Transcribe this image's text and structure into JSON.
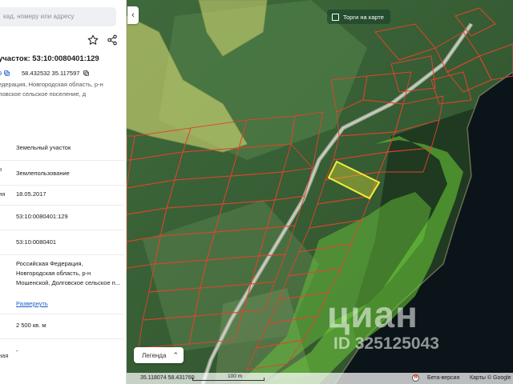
{
  "search": {
    "placeholder": "кад. номеру или адресу"
  },
  "panel": {
    "title": "участок: 53:10:0080401:129",
    "coord_prefix": "9",
    "coords": "58.432532 35.117597",
    "address_lines": [
      "едерация, Новгородская область, р-н",
      "ловское сельское поселение, д"
    ],
    "rows": [
      {
        "label": "",
        "value": "Земельный участок"
      },
      {
        "label": "о",
        "value": "Землепользование"
      },
      {
        "label": "ия",
        "value": "18.05.2017"
      },
      {
        "label": "",
        "value": "53:10:0080401:129"
      },
      {
        "label": "",
        "value": "53:10:0080401"
      },
      {
        "label": "",
        "value": "Российская Федерация, Новгородская область, р-н Мошенской, Долговское сельское п..."
      },
      {
        "label": "",
        "value": "2 500 кв. м"
      },
      {
        "label": "ная",
        "value": "-"
      }
    ],
    "expand_label": "Развернуть"
  },
  "map": {
    "auctions_label": "Торги на карте",
    "legend_label": "Легенда",
    "watermark_brand": "циан",
    "watermark_id": "ID 325125043",
    "cursor_coords": "35.118074 58.431760",
    "scale_label": "100 m",
    "beta_label": "Бета-версия",
    "attribution": "Карты  © Google"
  },
  "colors": {
    "accent_link": "#1a5cd1",
    "parcel_stroke": "#e0442d",
    "selected_parcel": "#f2ec3a",
    "forest_zone": "#6fcf3b",
    "yellow_zone": "#e4e57a"
  }
}
